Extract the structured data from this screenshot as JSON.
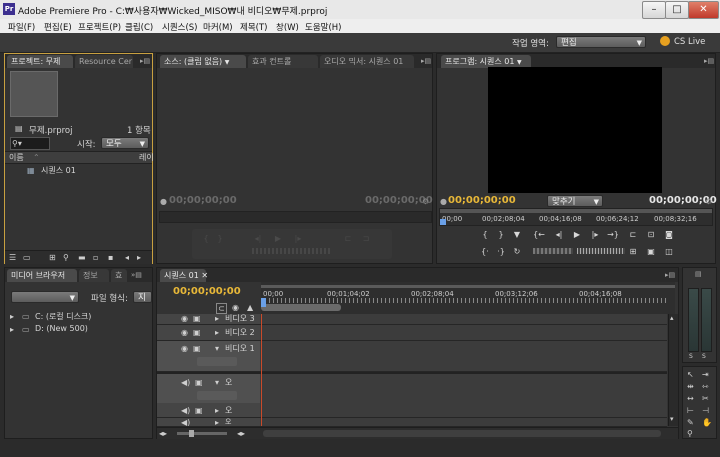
{
  "window": {
    "title": "Adobe Premiere Pro - C:₩사용자₩Wicked_MISO₩내 비디오₩무제.prproj",
    "icon_text": "Pr",
    "minimize": "–",
    "maximize": "□",
    "close": "✕"
  },
  "menu": [
    "파일(F)",
    "편집(E)",
    "프로젝트(P)",
    "클립(C)",
    "시퀀스(S)",
    "마커(M)",
    "제목(T)",
    "창(W)",
    "도움말(H)"
  ],
  "workspace": {
    "label": "작업 영역:",
    "value": "편집",
    "cslive": "CS Live"
  },
  "project_panel": {
    "tabs": [
      "프로젝트: 무제",
      "Resource Cer"
    ],
    "filename": "무제.prproj",
    "item_count": "1 항목",
    "search_placeholder": "",
    "start_label": "시작:",
    "start_value": "모두",
    "col_name": "이름",
    "col_label": "레이",
    "items": [
      "시퀀스 01"
    ]
  },
  "source_panel": {
    "tabs": [
      "소스: (클립 없음)",
      "효과 컨트롤",
      "오디오 믹서: 시퀀스 01"
    ],
    "tc_left": "00;00;00;00",
    "tc_right": "00;00;00;00"
  },
  "program_panel": {
    "tab": "프로그램: 시퀀스 01",
    "tc_left": "00;00;00;00",
    "fit": "맞추기",
    "tc_right": "00;00;00;00",
    "ruler": [
      "00;00",
      "00;02;08;04",
      "00;04;16;08",
      "00;06;24;12",
      "00;08;32;16"
    ]
  },
  "media_panel": {
    "tabs": [
      "미디어 브라우저",
      "정보",
      "효"
    ],
    "filetype_label": "파일 형식:",
    "filetype_value": "지원",
    "drives": [
      "C: (로컬 디스크)",
      "D: (New 500)"
    ]
  },
  "timeline": {
    "tab": "시퀀스 01",
    "timecode": "00;00;00;00",
    "ruler": [
      "00;00",
      "00;01;04;02",
      "00;02;08;04",
      "00;03;12;06",
      "00;04;16;08"
    ],
    "video_tracks": [
      "비디오 3",
      "비디오 2",
      "비디오 1"
    ],
    "audio_tracks": [
      "오",
      "오",
      "오"
    ]
  },
  "colors": {
    "timecode_yellow": "#e8b838",
    "active_border": "#c8a040",
    "panel_bg": "#333333",
    "playhead": "#c94a2a"
  }
}
